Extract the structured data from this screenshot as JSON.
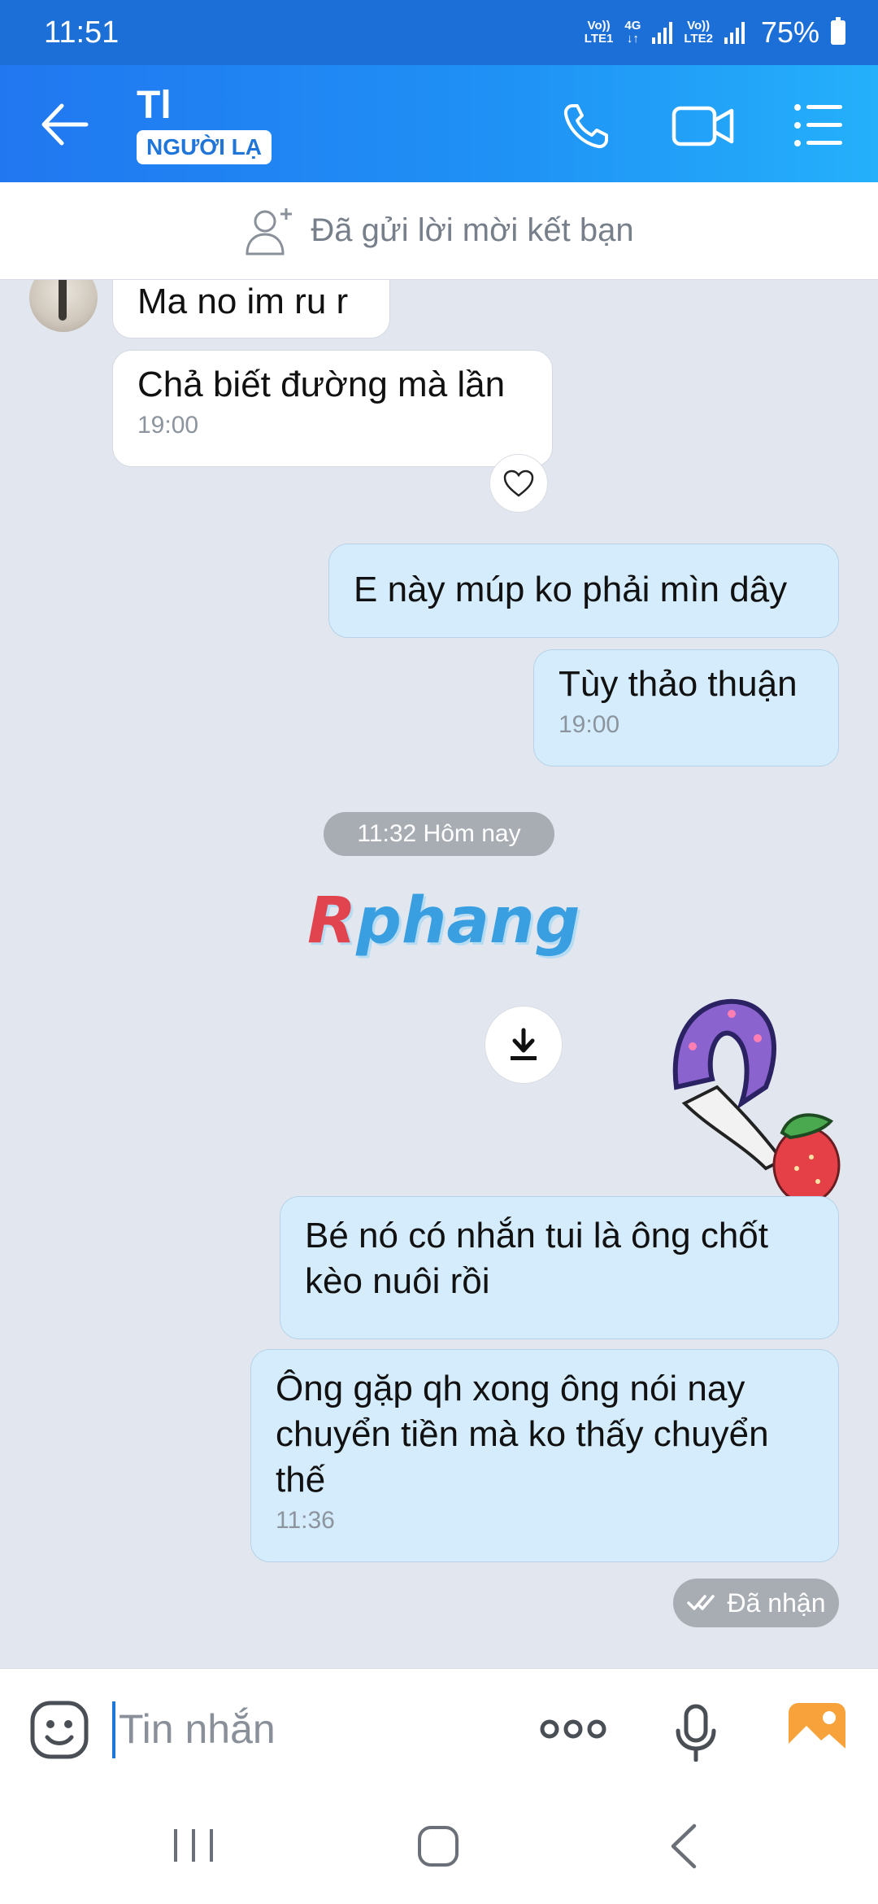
{
  "status_bar": {
    "time": "11:51",
    "sim1_top": "Vo))",
    "sim1_bottom": "LTE1",
    "net_type": "4G",
    "sim2_top": "Vo))",
    "sim2_bottom": "LTE2",
    "battery": "75%"
  },
  "header": {
    "contact_name": "Tl",
    "badge": "NGƯỜI LẠ",
    "icons": [
      "back-arrow-icon",
      "phone-icon",
      "video-icon",
      "menu-icon"
    ]
  },
  "friend_request": {
    "text": "Đã gửi lời mời kết bạn",
    "icon": "add-user-icon"
  },
  "messages": [
    {
      "side": "in",
      "text": "Ma no im ru r",
      "time": ""
    },
    {
      "side": "in",
      "text": "Chả biết đường mà lần",
      "time": "19:00"
    },
    {
      "side": "out",
      "text": "E này múp ko phải mìn dây",
      "time": ""
    },
    {
      "side": "out",
      "text": "Tùy thảo thuận",
      "time": "19:00"
    },
    {
      "side": "out",
      "text": "Bé nó có nhắn tui là ông chốt kèo nuôi rồi",
      "time": ""
    },
    {
      "side": "out",
      "text": "Ông gặp qh xong ông nói nay chuyển tiền mà ko thấy chuyển thế",
      "time": "11:36"
    }
  ],
  "date_separator": "11:32 Hôm nay",
  "watermark": {
    "first": "R",
    "rest": "phang"
  },
  "received_status": "Đã nhận",
  "input": {
    "placeholder": "Tin nhắn",
    "icons": [
      "emoji-icon",
      "more-dots-icon",
      "microphone-icon",
      "image-icon"
    ]
  },
  "colors": {
    "header_start": "#2177f0",
    "header_end": "#24b0fb",
    "outgoing_bubble": "#d4ecfc",
    "incoming_bubble": "#ffffff",
    "chat_background": "#e2e7ef"
  }
}
